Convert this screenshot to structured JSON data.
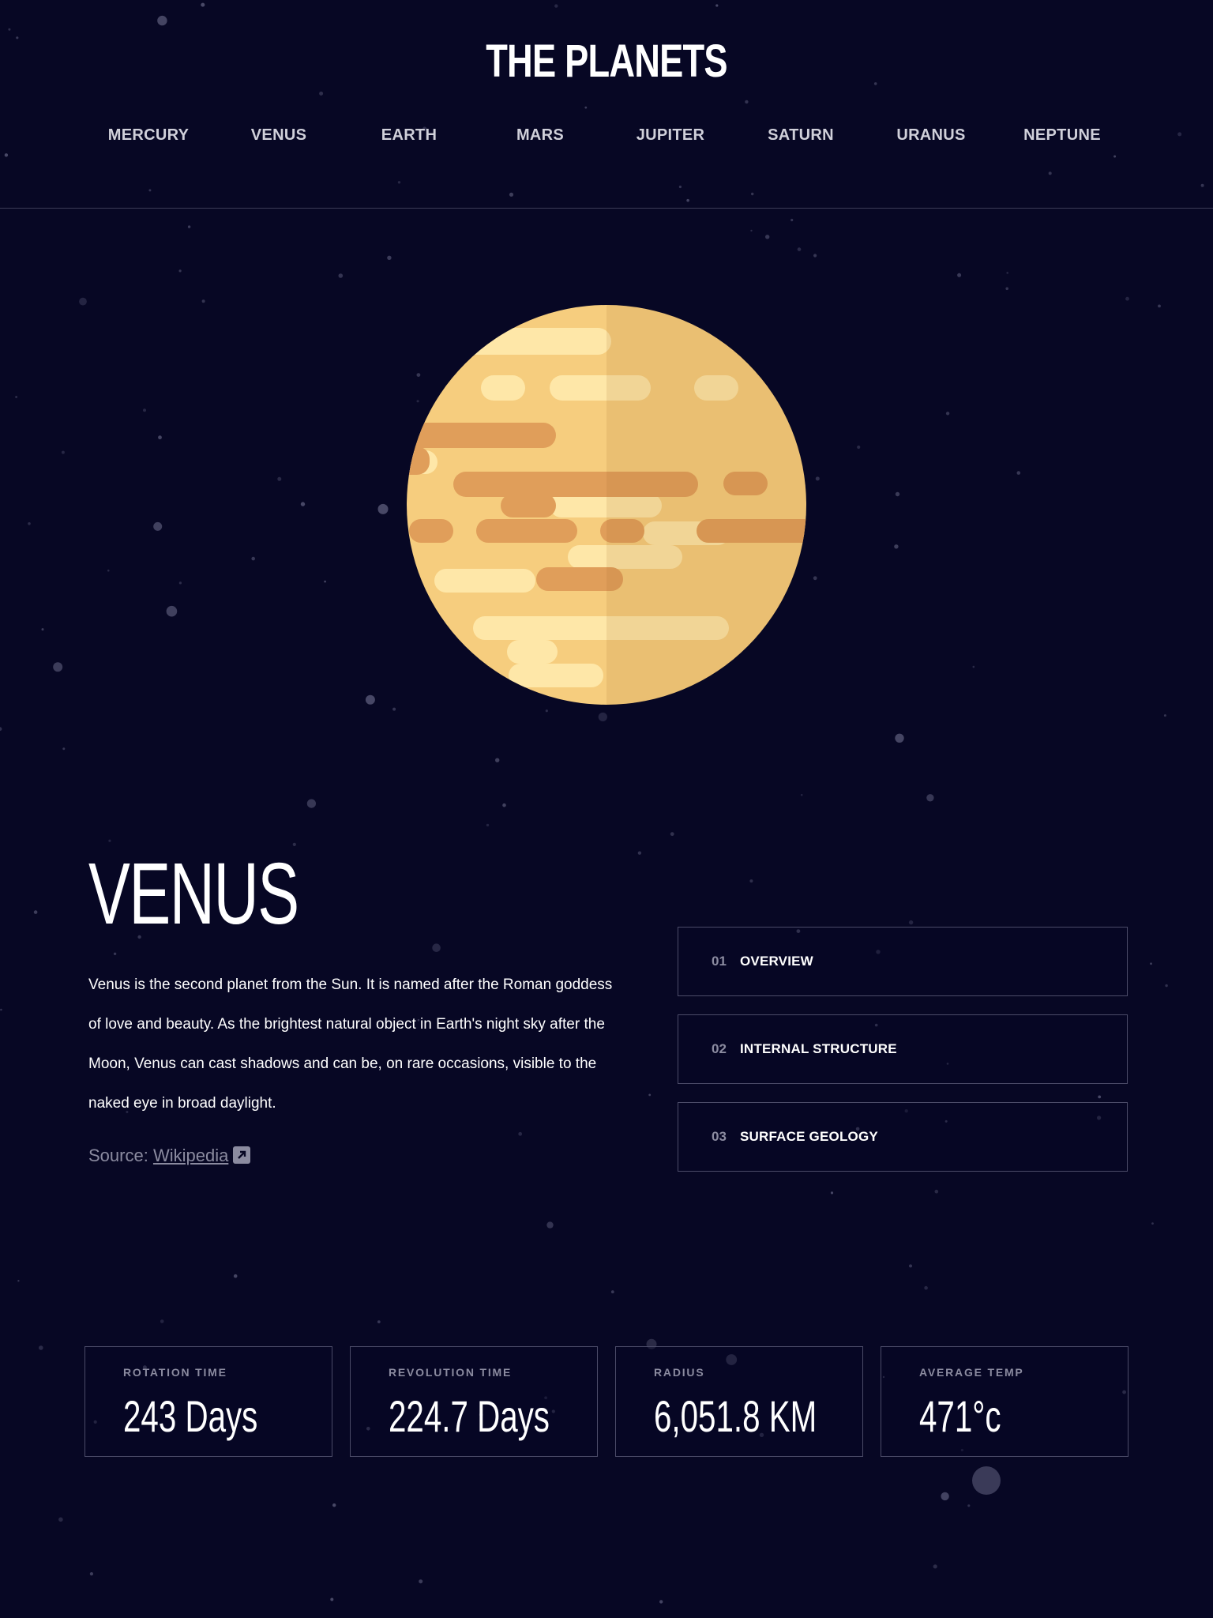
{
  "header": {
    "title": "THE PLANETS",
    "nav": [
      "MERCURY",
      "VENUS",
      "EARTH",
      "MARS",
      "JUPITER",
      "SATURN",
      "URANUS",
      "NEPTUNE"
    ]
  },
  "planet": {
    "name": "VENUS",
    "description": "Venus is the second planet from the Sun. It is named after the Roman goddess of love and beauty. As the brightest natural object in Earth's night sky after the Moon, Venus can cast shadows and can be, on rare occasions, visible to the naked eye in broad daylight.",
    "source_prefix": "Source:",
    "source_link": "Wikipedia",
    "image_icon": "venus-planet-illustration"
  },
  "tabs": [
    {
      "num": "01",
      "label": "OVERVIEW"
    },
    {
      "num": "02",
      "label": "INTERNAL STRUCTURE"
    },
    {
      "num": "03",
      "label": "SURFACE GEOLOGY"
    }
  ],
  "stats": [
    {
      "label": "ROTATION TIME",
      "value": "243 Days"
    },
    {
      "label": "REVOLUTION TIME",
      "value": "224.7 Days"
    },
    {
      "label": "RADIUS",
      "value": "6,051.8 KM"
    },
    {
      "label": "AVERAGE TEMP",
      "value": "471°c"
    }
  ],
  "colors": {
    "background": "#070724",
    "border": "#4b4b68",
    "muted_text": "#8b8ba0",
    "planet_light": "#fee7a8",
    "planet_mid": "#f6cd7e",
    "planet_dark": "#e09e5a"
  },
  "icons": {
    "external_link": "external-link-icon",
    "stars": "starfield-background"
  }
}
